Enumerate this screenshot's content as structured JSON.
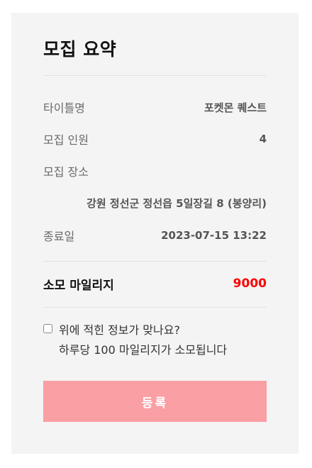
{
  "summary": {
    "title": "모집 요약",
    "rows": [
      {
        "label": "타이틀명",
        "value": "포켓몬 퀘스트"
      },
      {
        "label": "모집 인원",
        "value": "4"
      },
      {
        "label": "모집 장소",
        "value": ""
      },
      {
        "label": "종료일",
        "value": "2023-07-15 13:22"
      }
    ],
    "address": "강원 정선군 정선읍 5일장길 8 (봉양리)"
  },
  "mileage": {
    "label": "소모 마일리지",
    "value": "9000",
    "color": "#ff0000"
  },
  "confirm": {
    "line1": "위에 적힌 정보가 맞나요?",
    "line2": "하루당 100 마일리지가 소모됩니다",
    "checked": false
  },
  "submit": {
    "label": "등록",
    "color": "#fa9fa3"
  }
}
